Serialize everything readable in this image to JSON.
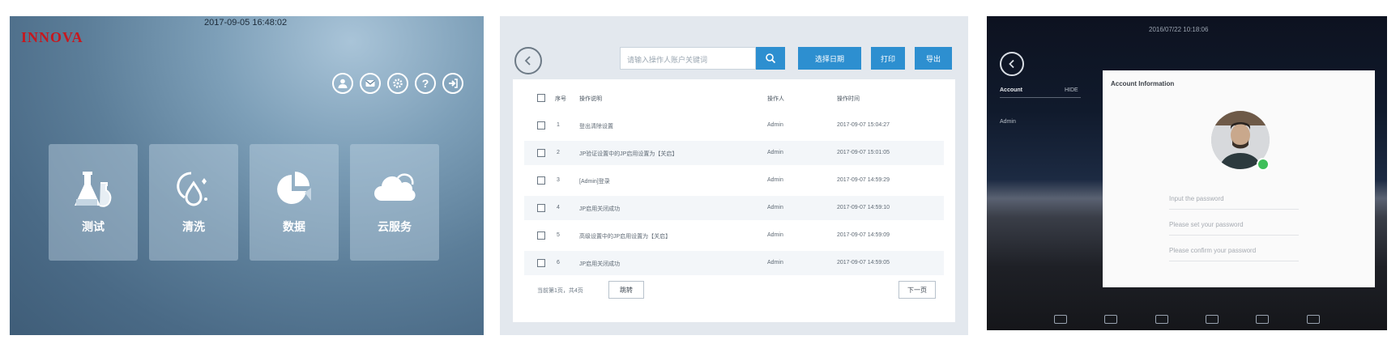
{
  "panel1": {
    "timestamp": "2017-09-05 16:48:02",
    "logo": "INNOVA",
    "header_icons": [
      "user-icon",
      "mail-icon",
      "settings-icon",
      "help-icon",
      "exit-icon"
    ],
    "tiles": [
      {
        "label": "测试",
        "icon": "flask-icon"
      },
      {
        "label": "清洗",
        "icon": "droplet-icon"
      },
      {
        "label": "数据",
        "icon": "pie-chart-icon"
      },
      {
        "label": "云服务",
        "icon": "cloud-icon"
      }
    ],
    "accent": "#c8171d"
  },
  "panel2": {
    "search_placeholder": "请输入操作人账户关键词",
    "buttons": {
      "select_date": "选择日期",
      "print": "打印",
      "export": "导出"
    },
    "columns": [
      "序号",
      "操作说明",
      "操作人",
      "操作时间"
    ],
    "rows": [
      {
        "no": "1",
        "desc": "登出清除设置",
        "op": "Admin",
        "time": "2017-09-07 15:04:27"
      },
      {
        "no": "2",
        "desc": "JP验证设置中的JP启用设置为【关启】",
        "op": "Admin",
        "time": "2017-09-07 15:01:05"
      },
      {
        "no": "3",
        "desc": "[Admin]登录",
        "op": "Admin",
        "time": "2017-09-07 14:59:29"
      },
      {
        "no": "4",
        "desc": "JP启用关闭成功",
        "op": "Admin",
        "time": "2017-09-07 14:59:10"
      },
      {
        "no": "5",
        "desc": "高级设置中的JP启用设置为【关启】",
        "op": "Admin",
        "time": "2017-09-07 14:59:09"
      },
      {
        "no": "6",
        "desc": "JP启用关闭成功",
        "op": "Admin",
        "time": "2017-09-07 14:59:05"
      }
    ],
    "footer": "当前第1页，共4页",
    "jump": "跳转",
    "next": "下一页",
    "accent": "#2d8fd0"
  },
  "panel3": {
    "title": "2016/07/22 10:18:06",
    "account_label": "Account",
    "hide_label": "HIDE",
    "admin_label": "Admin",
    "card_title": "Account Information",
    "fields": [
      "Input the password",
      "Please set your password",
      "Please confirm your password"
    ],
    "online_color": "#3fbf5a"
  }
}
